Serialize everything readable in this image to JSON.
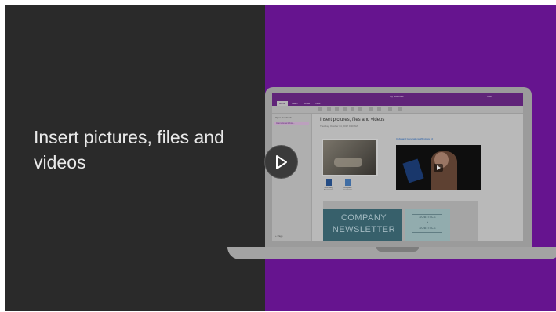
{
  "headline": "Insert pictures, files and videos",
  "play_icon": "play-icon",
  "colors": {
    "left_bg": "#2a2a2a",
    "right_bg": "#66148f",
    "accent": "#6e2a8a"
  },
  "app": {
    "window_title": "My Notebook",
    "user": "User",
    "tabs": [
      "Home",
      "Insert",
      "Draw",
      "View"
    ],
    "notebook": "Open Notebook",
    "section": "International Wood...",
    "add_page": "+ Page",
    "page_title": "Insert pictures, files and videos",
    "page_date": "Tuesday, October 04, 2017    9:30 AM",
    "video_link": "Cubs and Generations Windows 10",
    "attachments": [
      {
        "label": "Company Newsletter"
      },
      {
        "label": "Company Newsletter"
      }
    ],
    "newsletter": {
      "line1": "COMPANY",
      "line2": "NEWSLETTER",
      "sub1": "SUBTITLE",
      "bullet": "•",
      "sub2": "SUBTITLE"
    }
  }
}
